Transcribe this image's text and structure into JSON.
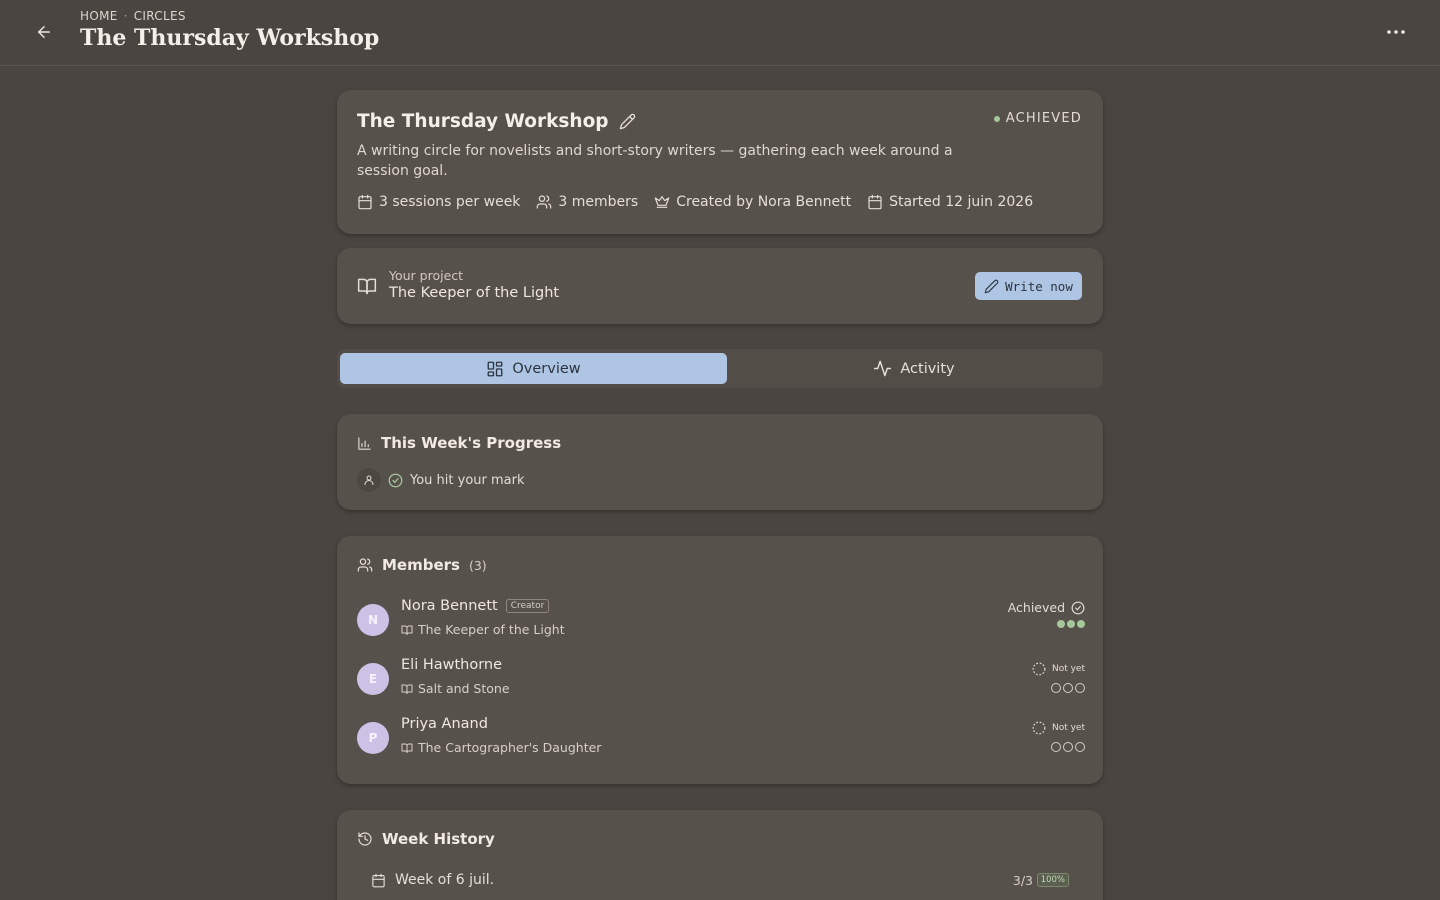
{
  "header": {
    "breadcrumb": [
      "HOME",
      "CIRCLES"
    ],
    "breadcrumb_sep": "·",
    "title": "The Thursday Workshop"
  },
  "circle": {
    "name": "The Thursday Workshop",
    "status": "ACHIEVED",
    "description": "A writing circle for novelists and short-story writers — gathering each week around a session goal.",
    "meta": {
      "sessions": "3 sessions per week",
      "members": "3 members",
      "creator": "Created by Nora Bennett",
      "started": "Started 12 juin 2026"
    }
  },
  "project": {
    "label": "Your project",
    "title": "The Keeper of the Light",
    "write_button": "Write now"
  },
  "tabs": [
    {
      "label": "Overview",
      "active": true
    },
    {
      "label": "Activity",
      "active": false
    }
  ],
  "progress": {
    "title": "This Week's Progress",
    "status_text": "You hit your mark"
  },
  "members": {
    "title": "Members",
    "count": "(3)",
    "creator_tag": "Creator",
    "list": [
      {
        "initial": "N",
        "name": "Nora Bennett",
        "book": "The Keeper of the Light",
        "status": "Achieved",
        "sessions_done": 3,
        "sessions_goal": 3,
        "is_creator": true
      },
      {
        "initial": "E",
        "name": "Eli Hawthorne",
        "book": "Salt and Stone",
        "status": "Not yet",
        "sessions_done": 0,
        "sessions_goal": 3,
        "is_creator": false
      },
      {
        "initial": "P",
        "name": "Priya Anand",
        "book": "The Cartographer's Daughter",
        "status": "Not yet",
        "sessions_done": 0,
        "sessions_goal": 3,
        "is_creator": false
      }
    ]
  },
  "history": {
    "title": "Week History",
    "weeks": [
      {
        "label": "Week of 6 juil.",
        "count": "3/3",
        "percent": "100%"
      }
    ]
  },
  "colors": {
    "background": "#4a4540",
    "card": "#57514b",
    "accent": "#aec5e3",
    "success": "#a6c79a",
    "avatar": "#cdc2e6"
  },
  "icons": {
    "back": "arrow-left-icon",
    "more": "more-horizontal-icon",
    "edit": "pencil-icon",
    "calendar": "calendar-icon",
    "users": "users-icon",
    "crown": "crown-icon",
    "book": "book-open-icon",
    "overview": "layout-grid-icon",
    "activity": "activity-icon",
    "chart": "bar-chart-icon",
    "user": "user-icon",
    "check": "check-circle-icon",
    "pending": "dashed-circle-icon",
    "history": "history-icon"
  }
}
